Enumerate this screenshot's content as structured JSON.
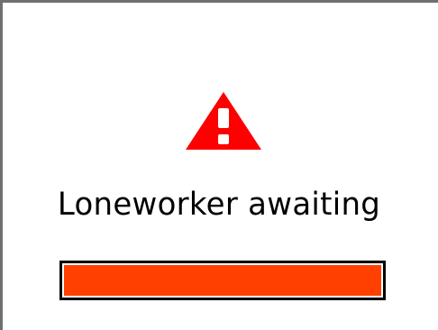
{
  "alert": {
    "icon": "warning-triangle-icon",
    "icon_color": "#ff0000",
    "message": "Loneworker awaiting"
  },
  "progress": {
    "fraction": 1.0,
    "fill_color": "#ff4000"
  }
}
